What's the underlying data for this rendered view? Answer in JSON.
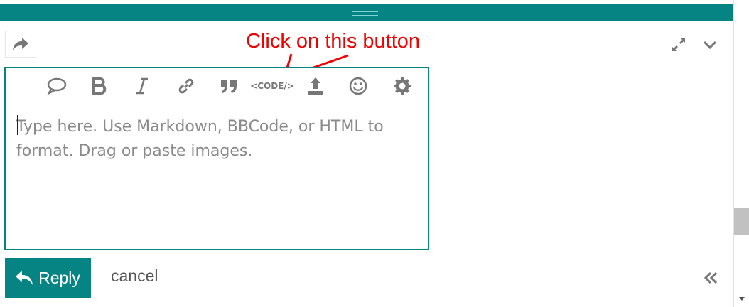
{
  "annotation": {
    "text": "Click on this button",
    "color": "#f00000"
  },
  "editor": {
    "placeholder": "Type here. Use Markdown, BBCode, or HTML to format. Drag or paste images.",
    "toolbar": [
      {
        "name": "quote-reply-icon"
      },
      {
        "name": "bold-icon"
      },
      {
        "name": "italic-icon"
      },
      {
        "name": "link-icon"
      },
      {
        "name": "blockquote-icon"
      },
      {
        "name": "code-icon",
        "label": "<CODE/>"
      },
      {
        "name": "upload-icon"
      },
      {
        "name": "emoji-icon"
      },
      {
        "name": "gear-icon"
      }
    ]
  },
  "actions": {
    "reply_label": "Reply",
    "cancel_label": "cancel"
  },
  "icons": {
    "share": "share-arrow-icon",
    "expand": "expand-icon",
    "collapse": "chevron-down-icon",
    "toggle": "double-chevron-left-icon"
  },
  "colors": {
    "accent": "#068484",
    "icon_gray": "#777777"
  }
}
